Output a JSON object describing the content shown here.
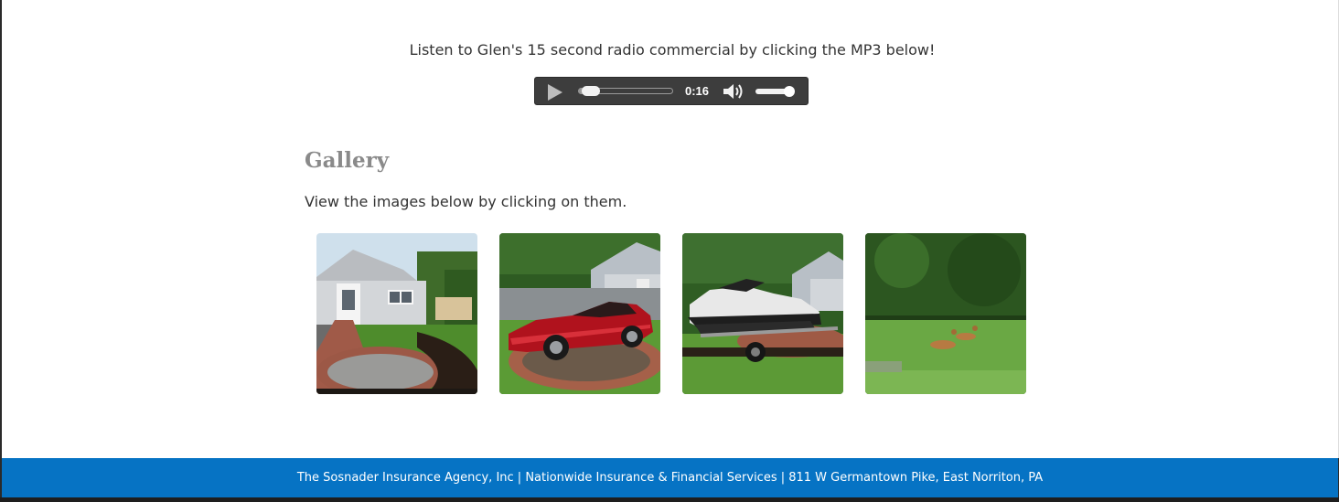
{
  "intro_text": "Listen to Glen's 15 second radio commercial by clicking the MP3 below!",
  "audio_player": {
    "time": "0:16",
    "progress": 0.06,
    "volume": 0.8,
    "icons": [
      "play-icon",
      "volume-icon"
    ]
  },
  "gallery": {
    "title": "Gallery",
    "subtitle": "View the images below by clicking on them."
  },
  "footer_text": "The Sosnader Insurance Agency, Inc | Nationwide Insurance & Financial Services | 811 W Germantown Pike, East Norriton, PA",
  "colors": {
    "footer_bg": "#0673c4",
    "heading": "#8a8a8a",
    "text": "#333333",
    "player_bg": "#3d3d3d"
  }
}
